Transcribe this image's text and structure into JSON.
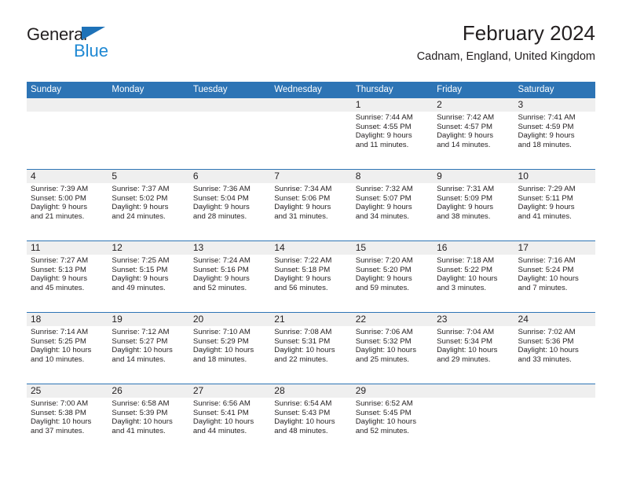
{
  "brand": {
    "name_part1": "General",
    "name_part2": "Blue",
    "triangle_icon": "blue-triangle-logo-mark",
    "colors": {
      "dark": "#231f20",
      "blue": "#1e88d3",
      "triangle": "#1e72b8"
    }
  },
  "header": {
    "title": "February 2024",
    "subtitle": "Cadnam, England, United Kingdom"
  },
  "theme": {
    "header_bg": "#2d74b5",
    "header_text": "#ffffff",
    "date_band_bg": "#efefef",
    "row_divider": "#2d74b5",
    "body_text": "#231f20"
  },
  "calendar": {
    "weekdays": [
      "Sunday",
      "Monday",
      "Tuesday",
      "Wednesday",
      "Thursday",
      "Friday",
      "Saturday"
    ],
    "weeks": [
      [
        {
          "day": "",
          "empty": true,
          "sunrise": "",
          "sunset": "",
          "daylight_line1": "",
          "daylight_line2": ""
        },
        {
          "day": "",
          "empty": true,
          "sunrise": "",
          "sunset": "",
          "daylight_line1": "",
          "daylight_line2": ""
        },
        {
          "day": "",
          "empty": true,
          "sunrise": "",
          "sunset": "",
          "daylight_line1": "",
          "daylight_line2": ""
        },
        {
          "day": "",
          "empty": true,
          "sunrise": "",
          "sunset": "",
          "daylight_line1": "",
          "daylight_line2": ""
        },
        {
          "day": "1",
          "empty": false,
          "sunrise": "Sunrise: 7:44 AM",
          "sunset": "Sunset: 4:55 PM",
          "daylight_line1": "Daylight: 9 hours",
          "daylight_line2": "and 11 minutes."
        },
        {
          "day": "2",
          "empty": false,
          "sunrise": "Sunrise: 7:42 AM",
          "sunset": "Sunset: 4:57 PM",
          "daylight_line1": "Daylight: 9 hours",
          "daylight_line2": "and 14 minutes."
        },
        {
          "day": "3",
          "empty": false,
          "sunrise": "Sunrise: 7:41 AM",
          "sunset": "Sunset: 4:59 PM",
          "daylight_line1": "Daylight: 9 hours",
          "daylight_line2": "and 18 minutes."
        }
      ],
      [
        {
          "day": "4",
          "empty": false,
          "sunrise": "Sunrise: 7:39 AM",
          "sunset": "Sunset: 5:00 PM",
          "daylight_line1": "Daylight: 9 hours",
          "daylight_line2": "and 21 minutes."
        },
        {
          "day": "5",
          "empty": false,
          "sunrise": "Sunrise: 7:37 AM",
          "sunset": "Sunset: 5:02 PM",
          "daylight_line1": "Daylight: 9 hours",
          "daylight_line2": "and 24 minutes."
        },
        {
          "day": "6",
          "empty": false,
          "sunrise": "Sunrise: 7:36 AM",
          "sunset": "Sunset: 5:04 PM",
          "daylight_line1": "Daylight: 9 hours",
          "daylight_line2": "and 28 minutes."
        },
        {
          "day": "7",
          "empty": false,
          "sunrise": "Sunrise: 7:34 AM",
          "sunset": "Sunset: 5:06 PM",
          "daylight_line1": "Daylight: 9 hours",
          "daylight_line2": "and 31 minutes."
        },
        {
          "day": "8",
          "empty": false,
          "sunrise": "Sunrise: 7:32 AM",
          "sunset": "Sunset: 5:07 PM",
          "daylight_line1": "Daylight: 9 hours",
          "daylight_line2": "and 34 minutes."
        },
        {
          "day": "9",
          "empty": false,
          "sunrise": "Sunrise: 7:31 AM",
          "sunset": "Sunset: 5:09 PM",
          "daylight_line1": "Daylight: 9 hours",
          "daylight_line2": "and 38 minutes."
        },
        {
          "day": "10",
          "empty": false,
          "sunrise": "Sunrise: 7:29 AM",
          "sunset": "Sunset: 5:11 PM",
          "daylight_line1": "Daylight: 9 hours",
          "daylight_line2": "and 41 minutes."
        }
      ],
      [
        {
          "day": "11",
          "empty": false,
          "sunrise": "Sunrise: 7:27 AM",
          "sunset": "Sunset: 5:13 PM",
          "daylight_line1": "Daylight: 9 hours",
          "daylight_line2": "and 45 minutes."
        },
        {
          "day": "12",
          "empty": false,
          "sunrise": "Sunrise: 7:25 AM",
          "sunset": "Sunset: 5:15 PM",
          "daylight_line1": "Daylight: 9 hours",
          "daylight_line2": "and 49 minutes."
        },
        {
          "day": "13",
          "empty": false,
          "sunrise": "Sunrise: 7:24 AM",
          "sunset": "Sunset: 5:16 PM",
          "daylight_line1": "Daylight: 9 hours",
          "daylight_line2": "and 52 minutes."
        },
        {
          "day": "14",
          "empty": false,
          "sunrise": "Sunrise: 7:22 AM",
          "sunset": "Sunset: 5:18 PM",
          "daylight_line1": "Daylight: 9 hours",
          "daylight_line2": "and 56 minutes."
        },
        {
          "day": "15",
          "empty": false,
          "sunrise": "Sunrise: 7:20 AM",
          "sunset": "Sunset: 5:20 PM",
          "daylight_line1": "Daylight: 9 hours",
          "daylight_line2": "and 59 minutes."
        },
        {
          "day": "16",
          "empty": false,
          "sunrise": "Sunrise: 7:18 AM",
          "sunset": "Sunset: 5:22 PM",
          "daylight_line1": "Daylight: 10 hours",
          "daylight_line2": "and 3 minutes."
        },
        {
          "day": "17",
          "empty": false,
          "sunrise": "Sunrise: 7:16 AM",
          "sunset": "Sunset: 5:24 PM",
          "daylight_line1": "Daylight: 10 hours",
          "daylight_line2": "and 7 minutes."
        }
      ],
      [
        {
          "day": "18",
          "empty": false,
          "sunrise": "Sunrise: 7:14 AM",
          "sunset": "Sunset: 5:25 PM",
          "daylight_line1": "Daylight: 10 hours",
          "daylight_line2": "and 10 minutes."
        },
        {
          "day": "19",
          "empty": false,
          "sunrise": "Sunrise: 7:12 AM",
          "sunset": "Sunset: 5:27 PM",
          "daylight_line1": "Daylight: 10 hours",
          "daylight_line2": "and 14 minutes."
        },
        {
          "day": "20",
          "empty": false,
          "sunrise": "Sunrise: 7:10 AM",
          "sunset": "Sunset: 5:29 PM",
          "daylight_line1": "Daylight: 10 hours",
          "daylight_line2": "and 18 minutes."
        },
        {
          "day": "21",
          "empty": false,
          "sunrise": "Sunrise: 7:08 AM",
          "sunset": "Sunset: 5:31 PM",
          "daylight_line1": "Daylight: 10 hours",
          "daylight_line2": "and 22 minutes."
        },
        {
          "day": "22",
          "empty": false,
          "sunrise": "Sunrise: 7:06 AM",
          "sunset": "Sunset: 5:32 PM",
          "daylight_line1": "Daylight: 10 hours",
          "daylight_line2": "and 25 minutes."
        },
        {
          "day": "23",
          "empty": false,
          "sunrise": "Sunrise: 7:04 AM",
          "sunset": "Sunset: 5:34 PM",
          "daylight_line1": "Daylight: 10 hours",
          "daylight_line2": "and 29 minutes."
        },
        {
          "day": "24",
          "empty": false,
          "sunrise": "Sunrise: 7:02 AM",
          "sunset": "Sunset: 5:36 PM",
          "daylight_line1": "Daylight: 10 hours",
          "daylight_line2": "and 33 minutes."
        }
      ],
      [
        {
          "day": "25",
          "empty": false,
          "sunrise": "Sunrise: 7:00 AM",
          "sunset": "Sunset: 5:38 PM",
          "daylight_line1": "Daylight: 10 hours",
          "daylight_line2": "and 37 minutes."
        },
        {
          "day": "26",
          "empty": false,
          "sunrise": "Sunrise: 6:58 AM",
          "sunset": "Sunset: 5:39 PM",
          "daylight_line1": "Daylight: 10 hours",
          "daylight_line2": "and 41 minutes."
        },
        {
          "day": "27",
          "empty": false,
          "sunrise": "Sunrise: 6:56 AM",
          "sunset": "Sunset: 5:41 PM",
          "daylight_line1": "Daylight: 10 hours",
          "daylight_line2": "and 44 minutes."
        },
        {
          "day": "28",
          "empty": false,
          "sunrise": "Sunrise: 6:54 AM",
          "sunset": "Sunset: 5:43 PM",
          "daylight_line1": "Daylight: 10 hours",
          "daylight_line2": "and 48 minutes."
        },
        {
          "day": "29",
          "empty": false,
          "sunrise": "Sunrise: 6:52 AM",
          "sunset": "Sunset: 5:45 PM",
          "daylight_line1": "Daylight: 10 hours",
          "daylight_line2": "and 52 minutes."
        },
        {
          "day": "",
          "empty": true,
          "sunrise": "",
          "sunset": "",
          "daylight_line1": "",
          "daylight_line2": ""
        },
        {
          "day": "",
          "empty": true,
          "sunrise": "",
          "sunset": "",
          "daylight_line1": "",
          "daylight_line2": ""
        }
      ]
    ]
  }
}
